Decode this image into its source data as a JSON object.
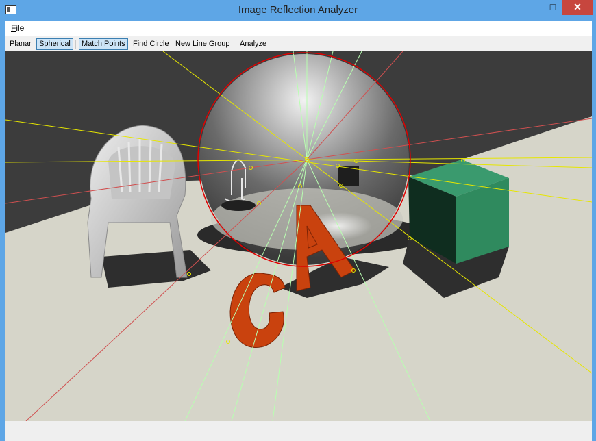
{
  "window": {
    "title": "Image Reflection Analyzer",
    "min_glyph": "—",
    "max_glyph": "□",
    "close_glyph": "✕"
  },
  "menu": {
    "file_mnemonic": "F",
    "file_rest": "ile"
  },
  "toolbar": {
    "planar": "Planar",
    "spherical": "Spherical",
    "match_points": "Match Points",
    "find_circle": "Find Circle",
    "new_line_group": "New Line Group",
    "analyze": "Analyze"
  },
  "colors": {
    "title_bar": "#5ea6e6",
    "close_button": "#c7463e",
    "active_button": "#cce4f7",
    "circle": "#e00000",
    "yellow_lines": "#e6e600",
    "red_lines": "#d05050",
    "green_lines": "#b8ffb0",
    "cube": "#2f8a5e",
    "letters": "#c9420e",
    "floor": "#d6d5c9",
    "wall": "#3c3c3c"
  }
}
